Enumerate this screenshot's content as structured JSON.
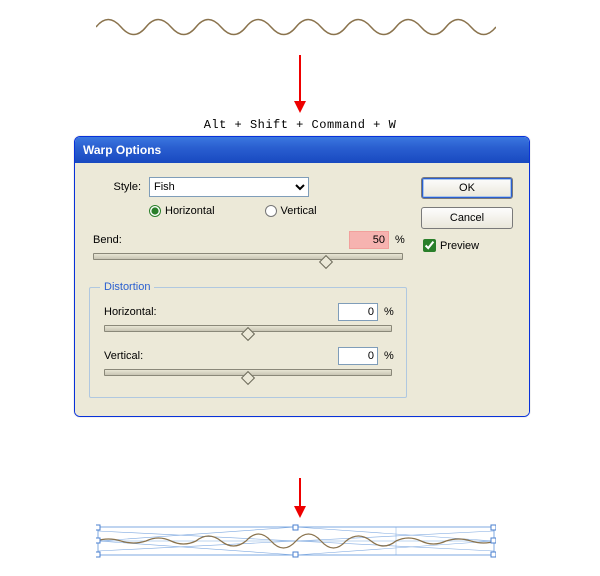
{
  "shortcut_text": "Alt + Shift + Command + W",
  "dialog": {
    "title": "Warp Options",
    "style_label": "Style:",
    "style_value": "Fish",
    "orientation": {
      "horizontal_label": "Horizontal",
      "vertical_label": "Vertical",
      "selected": "horizontal"
    },
    "bend": {
      "label": "Bend:",
      "value": "50",
      "unit": "%"
    },
    "distortion": {
      "legend": "Distortion",
      "horizontal": {
        "label": "Horizontal:",
        "value": "0",
        "unit": "%"
      },
      "vertical": {
        "label": "Vertical:",
        "value": "0",
        "unit": "%"
      }
    },
    "buttons": {
      "ok": "OK",
      "cancel": "Cancel"
    },
    "preview_label": "Preview"
  }
}
